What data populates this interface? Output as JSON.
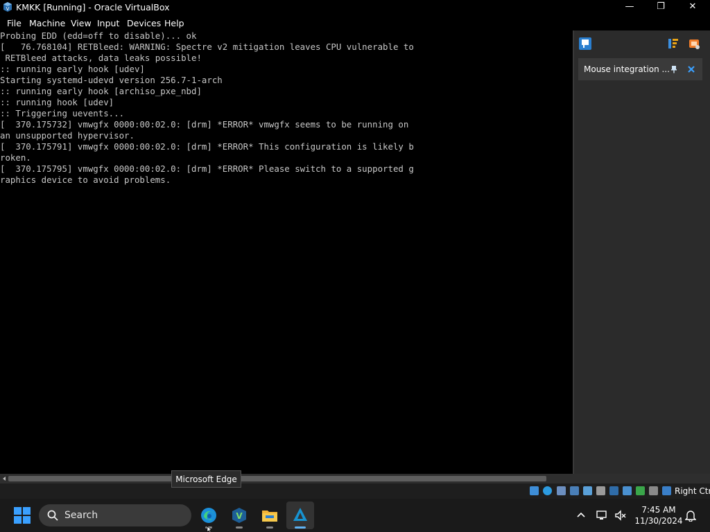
{
  "window": {
    "title": "KMKK [Running] - Oracle VirtualBox",
    "controls": {
      "minimize": "—",
      "maximize": "❐",
      "close": "✕"
    }
  },
  "menu": {
    "items": [
      "File",
      "Machine",
      "View",
      "Input",
      "Devices",
      "Help"
    ]
  },
  "console": {
    "lines": [
      "Probing EDD (edd=off to disable)... ok",
      "[   76.768104] RETBleed: WARNING: Spectre v2 mitigation leaves CPU vulnerable to",
      " RETBleed attacks, data leaks possible!",
      ":: running early hook [udev]",
      "Starting systemd-udevd version 256.7-1-arch",
      ":: running early hook [archiso_pxe_nbd]",
      ":: running hook [udev]",
      ":: Triggering uevents...",
      "[  370.175732] vmwgfx 0000:00:02.0: [drm] *ERROR* vmwgfx seems to be running on",
      "an unsupported hypervisor.",
      "[  370.175791] vmwgfx 0000:00:02.0: [drm] *ERROR* This configuration is likely b",
      "roken.",
      "[  370.175795] vmwgfx 0000:00:02.0: [drm] *ERROR* Please switch to a supported g",
      "raphics device to avoid problems."
    ]
  },
  "side_panel": {
    "notice_label": "Mouse integration ...",
    "icons": [
      "info-panel-icon",
      "sort-icon",
      "chip-icon",
      "pin-icon",
      "close-icon"
    ]
  },
  "statusbar": {
    "host_key": "Right Ctrl",
    "icons": [
      "optical-drive-icon",
      "audio-icon",
      "video-capture-icon",
      "shared-folders-icon",
      "usb-icon",
      "network-icon",
      "display-icon",
      "recording-icon",
      "hdd-icon",
      "cpu-icon",
      "mouse-icon",
      "keyboard-icon"
    ]
  },
  "tooltip": {
    "text": "Microsoft Edge"
  },
  "taskbar": {
    "search_placeholder": "Search",
    "apps": [
      "Microsoft Edge",
      "VirtualBox Manager",
      "File Explorer",
      "Arch VM"
    ],
    "time": "7:45 AM",
    "date": "11/30/2024"
  },
  "colors": {
    "console_bg": "#000000",
    "console_text": "#c8c8c8",
    "panel_bg": "#2b2b2b",
    "accent": "#0078d4"
  }
}
